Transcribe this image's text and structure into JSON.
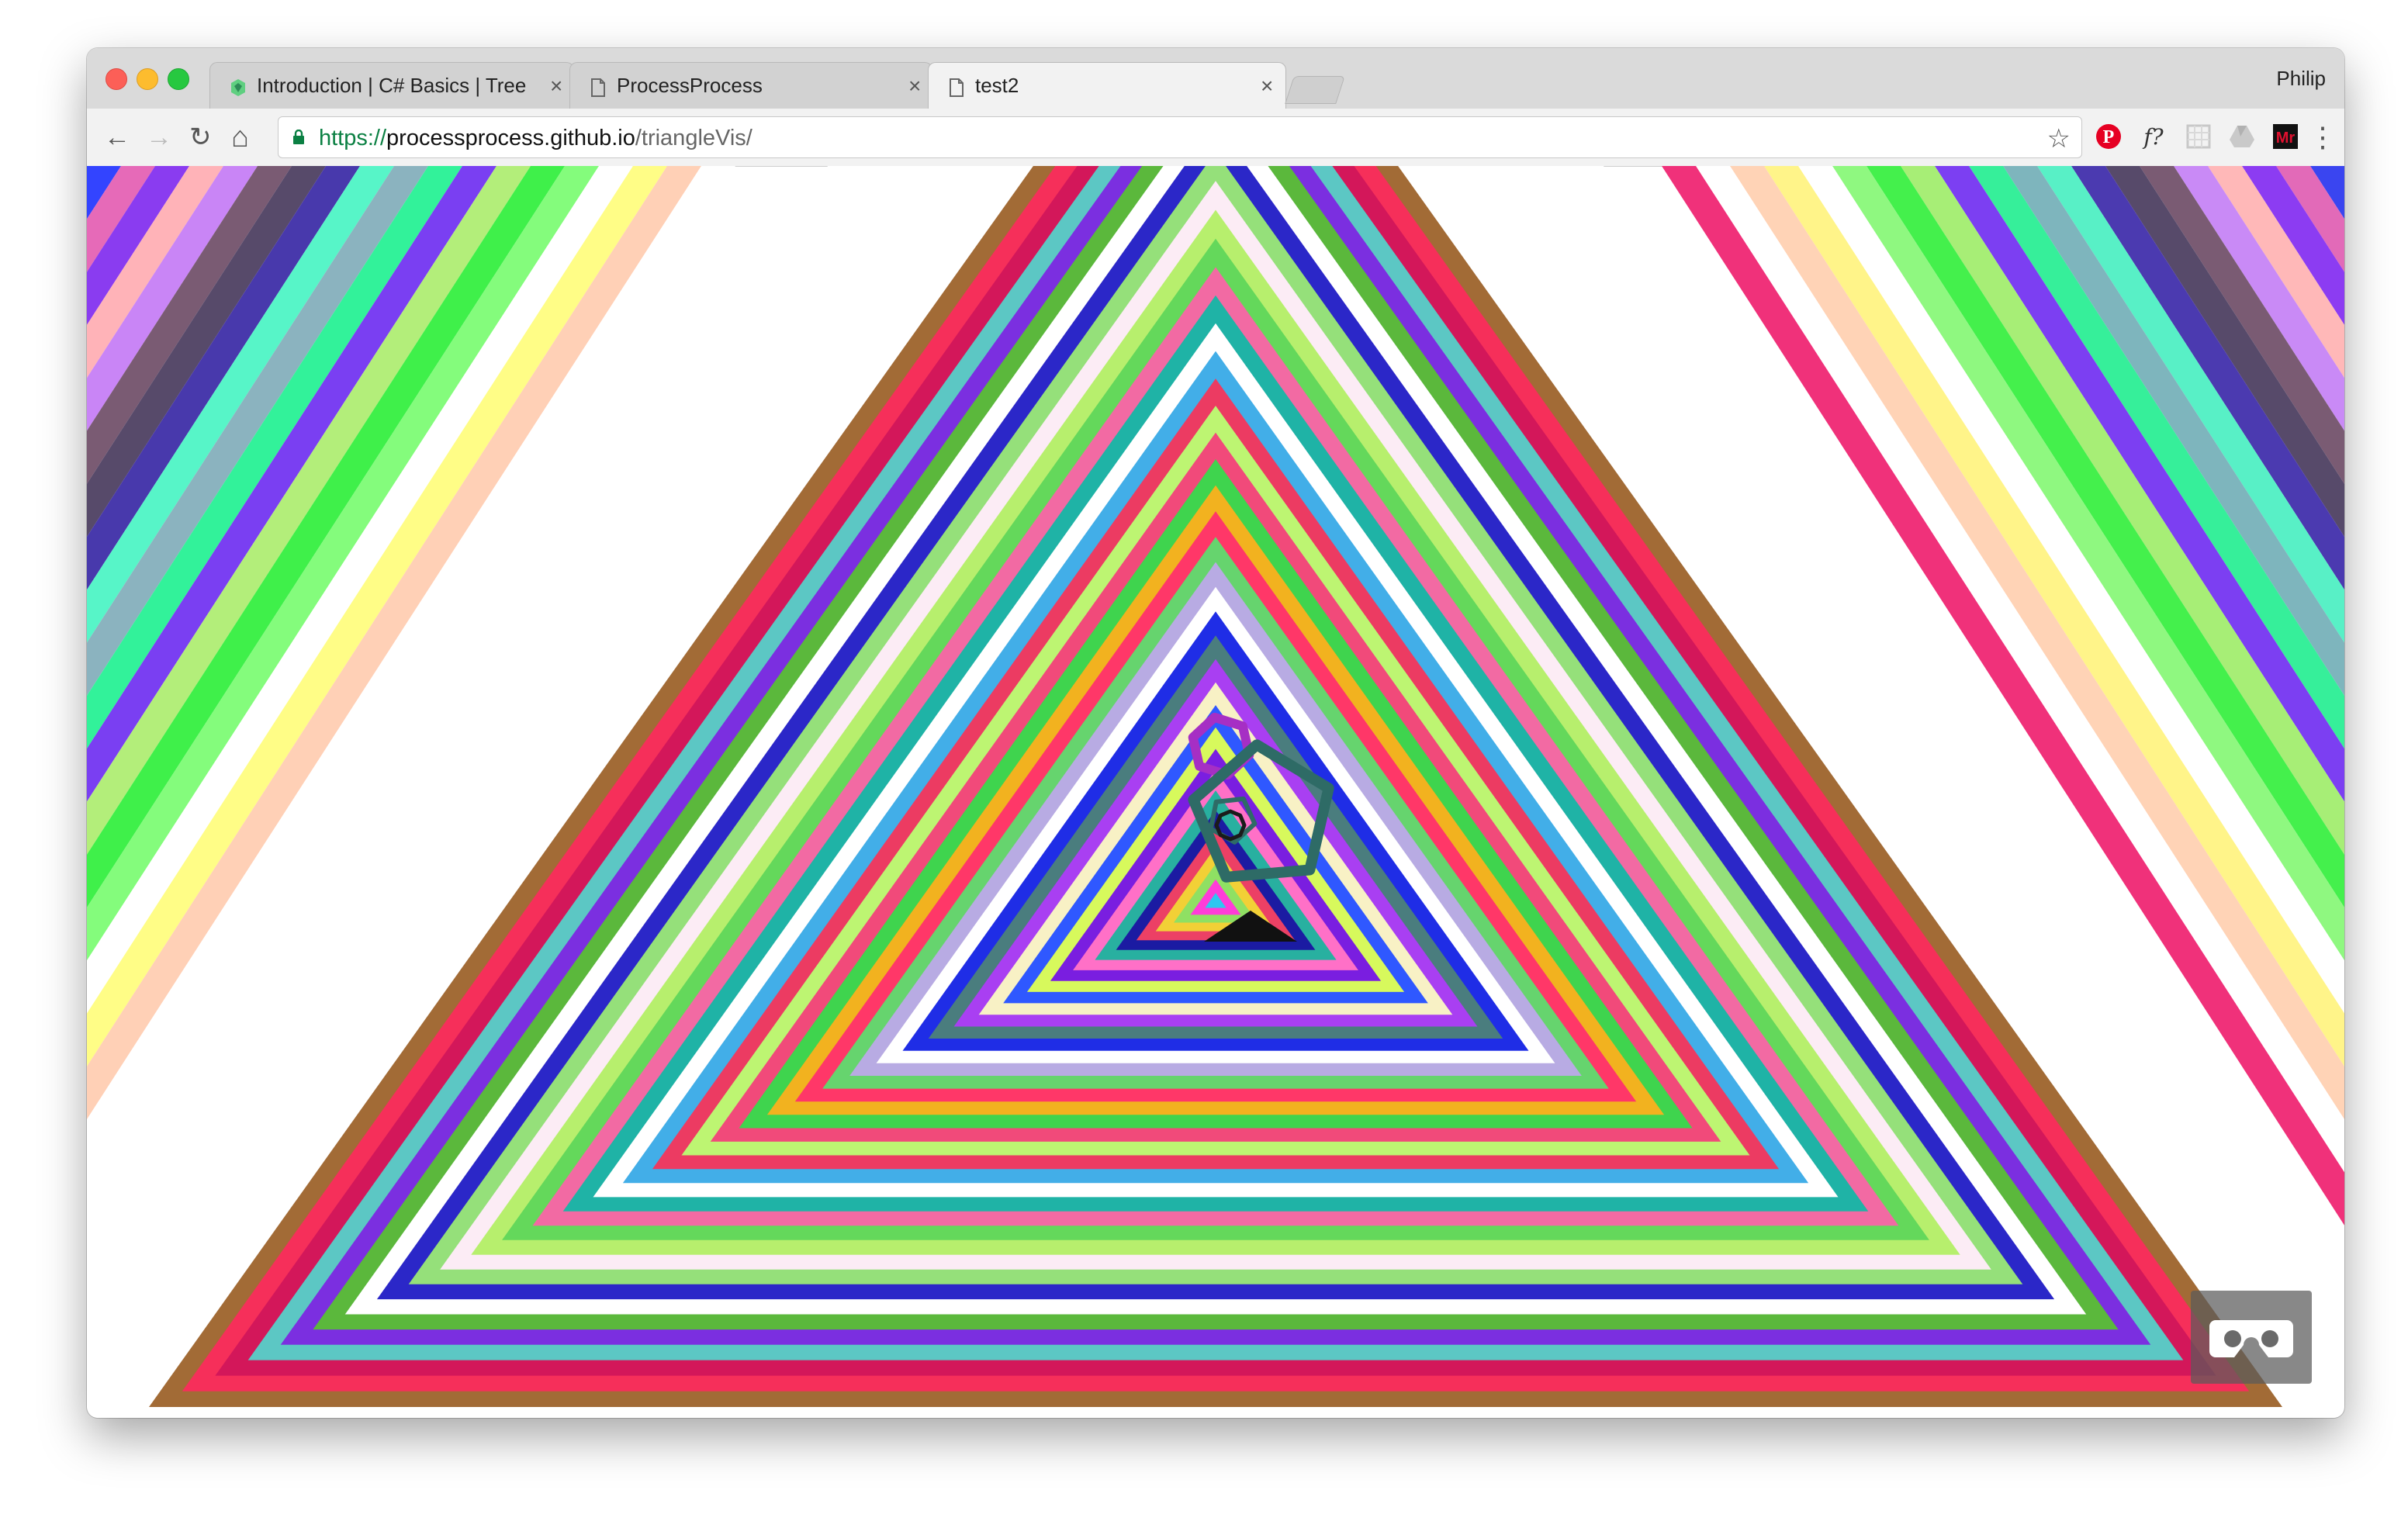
{
  "browser": {
    "tabs": [
      {
        "title": "Introduction | C# Basics | Tree",
        "active": false,
        "favicon": "treehouse-icon"
      },
      {
        "title": "ProcessProcess",
        "active": false,
        "favicon": "page-icon"
      },
      {
        "title": "test2",
        "active": true,
        "favicon": "page-icon"
      }
    ],
    "close_glyph": "×",
    "profile_name": "Philip",
    "url": {
      "scheme": "https://",
      "host": "processprocess.github.io",
      "path": "/triangleVis/"
    },
    "nav_icons": {
      "back": "←",
      "forward": "→",
      "reload": "↻",
      "home": "⌂",
      "star": "☆",
      "menu": "⋮"
    },
    "extensions": [
      "pinterest-icon",
      "whatfont-icon",
      "grid-extension-icon",
      "drive-icon",
      "momentum-icon"
    ],
    "extension_glyphs": {
      "pinterest": "P",
      "whatfont": "f?",
      "momentum": "Mr"
    },
    "colors": {
      "secure": "#0b8043",
      "pinterest": "#e60023",
      "momentum": "#c8102e"
    }
  },
  "visualization": {
    "description_icon": "vr-cardboard-icon",
    "palette": [
      "#a26b36",
      "#f62f5a",
      "#d3175a",
      "#5cc7c4",
      "#7b2fe0",
      "#5bb83c",
      "#ffffff",
      "#2b27c8",
      "#95e07a",
      "#fcecf5",
      "#b7ef6d",
      "#64d85b",
      "#f26aa3",
      "#1fb3a6",
      "#ffffff",
      "#42aee8",
      "#ec3b62",
      "#bdf572",
      "#f14a7a",
      "#3fd44e",
      "#f2b21f",
      "#ff3768",
      "#66d46e",
      "#b8abe3",
      "#ffffff",
      "#1f2de6",
      "#4a7d7e",
      "#a93ff2",
      "#f8f1c5",
      "#2f58ff",
      "#d7f95c",
      "#7a1ee0",
      "#ff70c7",
      "#28b0a0",
      "#1b1ba2",
      "#ec4065",
      "#f2d036",
      "#8fe063",
      "#ff3cd8",
      "#2fc6f0"
    ],
    "left_stripes": [
      "#3344ff",
      "#e66ab8",
      "#8a3cf0",
      "#ffb3b8",
      "#c985f6",
      "#7a5b73",
      "#574a6a",
      "#4839ac",
      "#57f5c8",
      "#8bb3bf",
      "#32f29a",
      "#7a3ff2",
      "#b3ee7a",
      "#3ff04a",
      "#84fc7c",
      "#ffffff",
      "#fffd86",
      "#ffd0b6",
      "#ffffff"
    ],
    "right_stripes": [
      "#3a45f0",
      "#e26ab8",
      "#8c3cf2",
      "#ffb8b8",
      "#c98af6",
      "#7a5b73",
      "#574a6a",
      "#4b3ab0",
      "#58f0c6",
      "#7eb5bd",
      "#36ef9a",
      "#7c3ff2",
      "#a7ee76",
      "#44f04c",
      "#8ff880",
      "#ffffff",
      "#fff489",
      "#ffd3b6",
      "#ffffff",
      "#f0317a"
    ],
    "shapes": [
      {
        "type": "pentagon",
        "color": "#2e6b66",
        "stroke": 14
      },
      {
        "type": "hexagon",
        "color": "#a62fc4",
        "stroke": 12
      }
    ]
  }
}
